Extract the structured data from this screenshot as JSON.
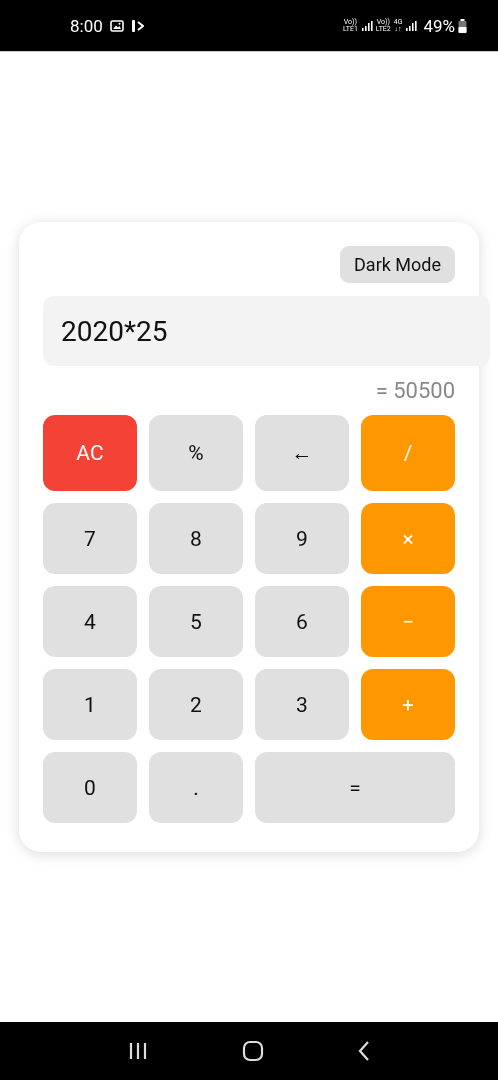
{
  "status_bar": {
    "time": "8:00",
    "network": [
      {
        "top": "Vo))",
        "bottom": "LTE1"
      },
      {
        "top": "Vo))",
        "bottom": "LTE2"
      },
      {
        "top": "4G",
        "bottom": "↓↑"
      }
    ],
    "battery": "49%"
  },
  "calculator": {
    "theme_button": "Dark Mode",
    "expression": "2020*25",
    "result": "= 50500",
    "keys": [
      {
        "label": "AC",
        "kind": "clear",
        "wide": false
      },
      {
        "label": "%",
        "kind": "function",
        "wide": false
      },
      {
        "label": "←",
        "kind": "function",
        "wide": false
      },
      {
        "label": "/",
        "kind": "operator",
        "wide": false
      },
      {
        "label": "7",
        "kind": "digit",
        "wide": false
      },
      {
        "label": "8",
        "kind": "digit",
        "wide": false
      },
      {
        "label": "9",
        "kind": "digit",
        "wide": false
      },
      {
        "label": "×",
        "kind": "operator",
        "wide": false
      },
      {
        "label": "4",
        "kind": "digit",
        "wide": false
      },
      {
        "label": "5",
        "kind": "digit",
        "wide": false
      },
      {
        "label": "6",
        "kind": "digit",
        "wide": false
      },
      {
        "label": "−",
        "kind": "operator",
        "wide": false
      },
      {
        "label": "1",
        "kind": "digit",
        "wide": false
      },
      {
        "label": "2",
        "kind": "digit",
        "wide": false
      },
      {
        "label": "3",
        "kind": "digit",
        "wide": false
      },
      {
        "label": "+",
        "kind": "operator",
        "wide": false
      },
      {
        "label": "0",
        "kind": "digit",
        "wide": false
      },
      {
        "label": ".",
        "kind": "digit",
        "wide": false
      },
      {
        "label": "=",
        "kind": "function",
        "wide": true
      }
    ]
  }
}
